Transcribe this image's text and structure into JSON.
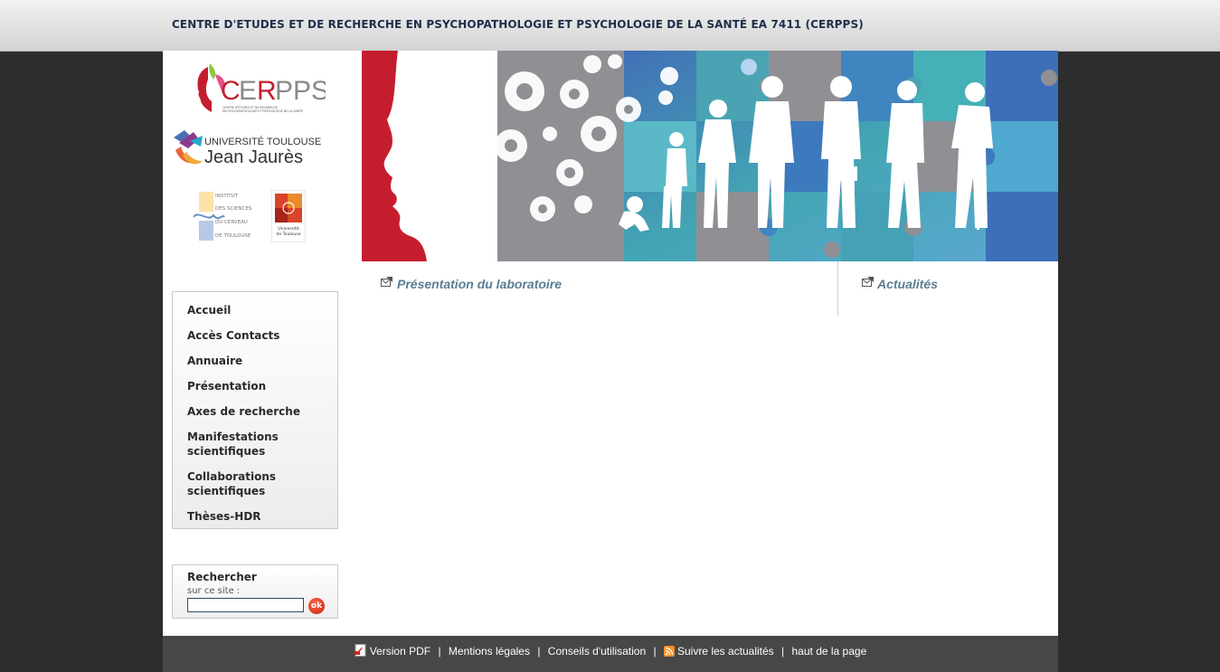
{
  "header": {
    "title": "CENTRE D'ETUDES ET DE RECHERCHE EN PSYCHOPATHOLOGIE ET PSYCHOLOGIE DE LA SANTÉ EA 7411 (CERPPS)"
  },
  "logos": {
    "cerpps": "CERPPS",
    "cerpps_small": "CENTRE D'ÉTUDES ET DE RECHERCHE EN PSYCHOPATHOLOGIE ET PSYCHOLOGIE DE LA SANTÉ",
    "ut2j_line1": "UNIVERSITÉ TOULOUSE",
    "ut2j_line2": "Jean Jaurès",
    "isc": [
      "INSTITUT",
      "DES SCIENCES",
      "DU CERVEAU",
      "DE TOULOUSE"
    ],
    "ut": [
      "Université",
      "de Toulouse"
    ]
  },
  "nav": {
    "items": [
      {
        "label": "Accueil"
      },
      {
        "label": "Accès Contacts"
      },
      {
        "label": "Annuaire"
      },
      {
        "label": "Présentation"
      },
      {
        "label": "Axes de recherche"
      },
      {
        "label": "Manifestations scientifiques"
      },
      {
        "label": "Collaborations scientifiques"
      },
      {
        "label": "Thèses-HDR"
      }
    ]
  },
  "search": {
    "title": "Rechercher",
    "subtitle": "sur ce site :",
    "value": "",
    "button": "ok"
  },
  "content": {
    "left_title": "Présentation du laboratoire",
    "right_title": "Actualités"
  },
  "footer": {
    "version_pdf": "Version PDF",
    "mentions": "Mentions légales",
    "conseils": "Conseils d'utilisation",
    "suivre": "Suivre les actualités",
    "haut": "haut de la page",
    "separator": "|"
  },
  "colors": {
    "header_text": "#1d2f4a",
    "banner_red": "#c41e2e",
    "link_title": "#5a7d93",
    "footer_bg": "#474747",
    "page_bg": "#2d2d2d"
  }
}
